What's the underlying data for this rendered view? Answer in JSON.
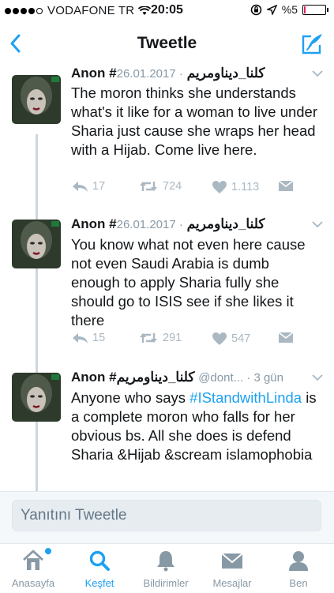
{
  "status_bar": {
    "carrier": "VODAFONE TR",
    "time": "20:05",
    "battery": "%5"
  },
  "nav": {
    "title": "Tweetle",
    "back_icon": "chevron-left-icon",
    "compose_icon": "compose-tweet-icon"
  },
  "tweets": [
    {
      "name": "Anon #كلنا_ديناومريم",
      "meta": "· 26.01.2017",
      "text": "The moron thinks she understands what's it like for a woman to live under Sharia just cause she wraps her head with a Hijab. Come live here.",
      "replies": "17",
      "retweets": "724",
      "likes": "1.113"
    },
    {
      "name": "Anon #كلنا_ديناومريم",
      "meta": "· 26.01.2017",
      "text": "You know what not even here cause not even Saudi Arabia is dumb enough to apply Sharia fully she should go to ISIS see if she likes it there",
      "replies": "15",
      "retweets": "291",
      "likes": "547"
    },
    {
      "name": "Anon #كلنا_ديناومريم",
      "meta": "@dont... · 3 gün",
      "text_before": "Anyone who says ",
      "hashtag": "#IStandwithLinda",
      "text_after": " is a complete moron who falls for her obvious bs. All she does is defend Sharia &Hijab &scream islamophobia"
    }
  ],
  "reply": {
    "placeholder": "Yanıtını Tweetle"
  },
  "tabs": [
    {
      "label": "Anasayfa",
      "icon": "home-icon"
    },
    {
      "label": "Keşfet",
      "icon": "search-icon",
      "active": true
    },
    {
      "label": "Bildirimler",
      "icon": "bell-icon"
    },
    {
      "label": "Mesajlar",
      "icon": "envelope-icon"
    },
    {
      "label": "Ben",
      "icon": "profile-icon"
    }
  ],
  "colors": {
    "accent": "#1da1f2",
    "muted": "#8899a6",
    "thread_line": "#ccd6dd"
  }
}
